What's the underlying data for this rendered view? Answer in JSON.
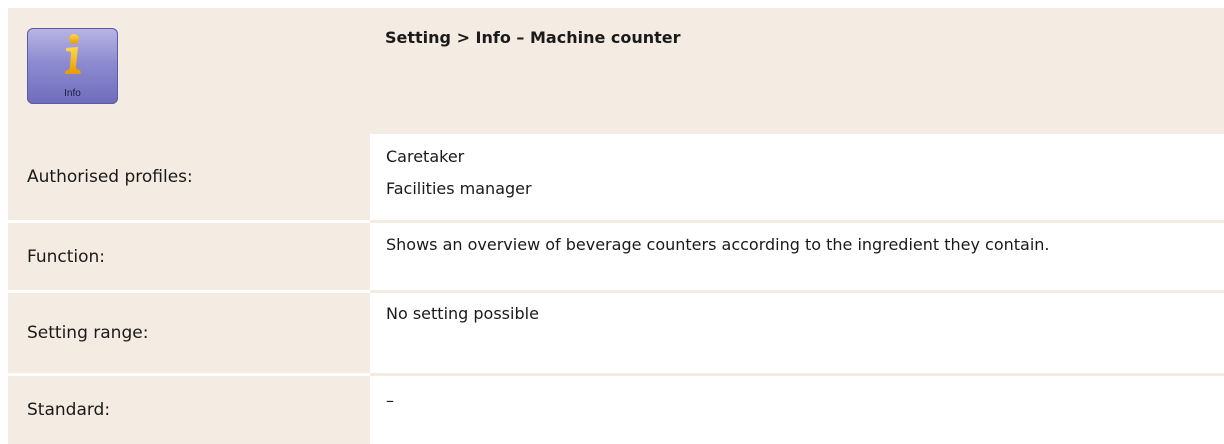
{
  "header": {
    "icon_name": "info-icon",
    "icon_caption": "Info",
    "title": "Setting > Info – Machine counter"
  },
  "rows": [
    {
      "label": "Authorised profiles:",
      "values": [
        "Caretaker",
        "Facilities manager"
      ]
    },
    {
      "label": "Function:",
      "values": [
        "Shows an overview of beverage counters according to the ingredient they contain."
      ]
    },
    {
      "label": "Setting range:",
      "values": [
        "No setting possible"
      ]
    },
    {
      "label": "Standard:",
      "values": [
        "–"
      ]
    }
  ],
  "colors": {
    "label_background": "#f4ebe2",
    "value_background": "#ffffff",
    "icon_gradient_top": "#b9b6e4",
    "icon_gradient_bottom": "#6f6dbc",
    "icon_glyph": "#f5b100"
  }
}
